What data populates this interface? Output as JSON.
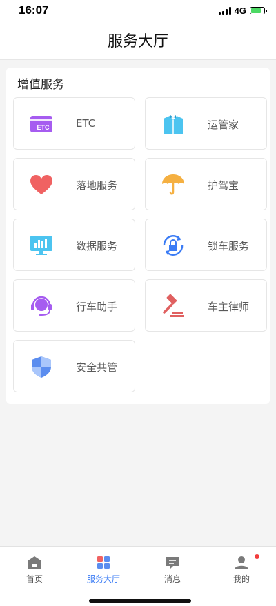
{
  "status": {
    "time": "16:07",
    "network": "4G",
    "battery_level": 0.8
  },
  "header": {
    "title": "服务大厅"
  },
  "section": {
    "title": "增值服务"
  },
  "services": [
    {
      "label": "ETC",
      "icon": "etc-card-icon",
      "icon_text": "_ETC",
      "color": "#a65cf0"
    },
    {
      "label": "运管家",
      "icon": "butler-suit-icon",
      "color": "#4cc4f0"
    },
    {
      "label": "落地服务",
      "icon": "heart-icon",
      "color": "#f06262"
    },
    {
      "label": "护驾宝",
      "icon": "umbrella-icon",
      "color": "#f5b041"
    },
    {
      "label": "数据服务",
      "icon": "monitor-chart-icon",
      "color": "#4cc4f0"
    },
    {
      "label": "锁车服务",
      "icon": "lock-refresh-icon",
      "color": "#3b7cf5"
    },
    {
      "label": "行车助手",
      "icon": "headset-assistant-icon",
      "color": "#a65cf0"
    },
    {
      "label": "车主律师",
      "icon": "gavel-icon",
      "color": "#e06060"
    },
    {
      "label": "安全共管",
      "icon": "shield-icon",
      "color": "#5b8def"
    }
  ],
  "tabbar": {
    "items": [
      {
        "label": "首页",
        "icon": "home-icon"
      },
      {
        "label": "服务大厅",
        "icon": "grid-icon",
        "active": true
      },
      {
        "label": "消息",
        "icon": "message-icon"
      },
      {
        "label": "我的",
        "icon": "user-icon",
        "badge": true
      }
    ]
  },
  "colors": {
    "accent": "#3b7cf5",
    "text": "#5a5a5a",
    "badge": "#f23d3d"
  }
}
